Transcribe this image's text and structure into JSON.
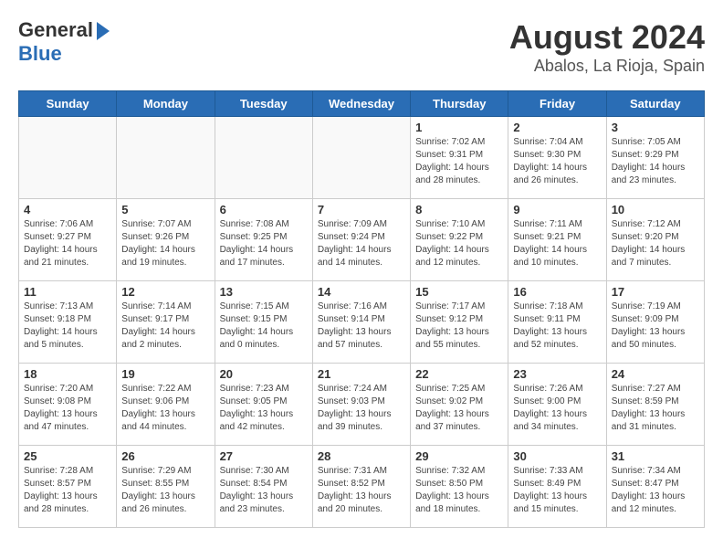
{
  "header": {
    "logo_general": "General",
    "logo_blue": "Blue",
    "month": "August 2024",
    "location": "Abalos, La Rioja, Spain"
  },
  "weekdays": [
    "Sunday",
    "Monday",
    "Tuesday",
    "Wednesday",
    "Thursday",
    "Friday",
    "Saturday"
  ],
  "weeks": [
    [
      {
        "day": "",
        "info": ""
      },
      {
        "day": "",
        "info": ""
      },
      {
        "day": "",
        "info": ""
      },
      {
        "day": "",
        "info": ""
      },
      {
        "day": "1",
        "info": "Sunrise: 7:02 AM\nSunset: 9:31 PM\nDaylight: 14 hours\nand 28 minutes."
      },
      {
        "day": "2",
        "info": "Sunrise: 7:04 AM\nSunset: 9:30 PM\nDaylight: 14 hours\nand 26 minutes."
      },
      {
        "day": "3",
        "info": "Sunrise: 7:05 AM\nSunset: 9:29 PM\nDaylight: 14 hours\nand 23 minutes."
      }
    ],
    [
      {
        "day": "4",
        "info": "Sunrise: 7:06 AM\nSunset: 9:27 PM\nDaylight: 14 hours\nand 21 minutes."
      },
      {
        "day": "5",
        "info": "Sunrise: 7:07 AM\nSunset: 9:26 PM\nDaylight: 14 hours\nand 19 minutes."
      },
      {
        "day": "6",
        "info": "Sunrise: 7:08 AM\nSunset: 9:25 PM\nDaylight: 14 hours\nand 17 minutes."
      },
      {
        "day": "7",
        "info": "Sunrise: 7:09 AM\nSunset: 9:24 PM\nDaylight: 14 hours\nand 14 minutes."
      },
      {
        "day": "8",
        "info": "Sunrise: 7:10 AM\nSunset: 9:22 PM\nDaylight: 14 hours\nand 12 minutes."
      },
      {
        "day": "9",
        "info": "Sunrise: 7:11 AM\nSunset: 9:21 PM\nDaylight: 14 hours\nand 10 minutes."
      },
      {
        "day": "10",
        "info": "Sunrise: 7:12 AM\nSunset: 9:20 PM\nDaylight: 14 hours\nand 7 minutes."
      }
    ],
    [
      {
        "day": "11",
        "info": "Sunrise: 7:13 AM\nSunset: 9:18 PM\nDaylight: 14 hours\nand 5 minutes."
      },
      {
        "day": "12",
        "info": "Sunrise: 7:14 AM\nSunset: 9:17 PM\nDaylight: 14 hours\nand 2 minutes."
      },
      {
        "day": "13",
        "info": "Sunrise: 7:15 AM\nSunset: 9:15 PM\nDaylight: 14 hours\nand 0 minutes."
      },
      {
        "day": "14",
        "info": "Sunrise: 7:16 AM\nSunset: 9:14 PM\nDaylight: 13 hours\nand 57 minutes."
      },
      {
        "day": "15",
        "info": "Sunrise: 7:17 AM\nSunset: 9:12 PM\nDaylight: 13 hours\nand 55 minutes."
      },
      {
        "day": "16",
        "info": "Sunrise: 7:18 AM\nSunset: 9:11 PM\nDaylight: 13 hours\nand 52 minutes."
      },
      {
        "day": "17",
        "info": "Sunrise: 7:19 AM\nSunset: 9:09 PM\nDaylight: 13 hours\nand 50 minutes."
      }
    ],
    [
      {
        "day": "18",
        "info": "Sunrise: 7:20 AM\nSunset: 9:08 PM\nDaylight: 13 hours\nand 47 minutes."
      },
      {
        "day": "19",
        "info": "Sunrise: 7:22 AM\nSunset: 9:06 PM\nDaylight: 13 hours\nand 44 minutes."
      },
      {
        "day": "20",
        "info": "Sunrise: 7:23 AM\nSunset: 9:05 PM\nDaylight: 13 hours\nand 42 minutes."
      },
      {
        "day": "21",
        "info": "Sunrise: 7:24 AM\nSunset: 9:03 PM\nDaylight: 13 hours\nand 39 minutes."
      },
      {
        "day": "22",
        "info": "Sunrise: 7:25 AM\nSunset: 9:02 PM\nDaylight: 13 hours\nand 37 minutes."
      },
      {
        "day": "23",
        "info": "Sunrise: 7:26 AM\nSunset: 9:00 PM\nDaylight: 13 hours\nand 34 minutes."
      },
      {
        "day": "24",
        "info": "Sunrise: 7:27 AM\nSunset: 8:59 PM\nDaylight: 13 hours\nand 31 minutes."
      }
    ],
    [
      {
        "day": "25",
        "info": "Sunrise: 7:28 AM\nSunset: 8:57 PM\nDaylight: 13 hours\nand 28 minutes."
      },
      {
        "day": "26",
        "info": "Sunrise: 7:29 AM\nSunset: 8:55 PM\nDaylight: 13 hours\nand 26 minutes."
      },
      {
        "day": "27",
        "info": "Sunrise: 7:30 AM\nSunset: 8:54 PM\nDaylight: 13 hours\nand 23 minutes."
      },
      {
        "day": "28",
        "info": "Sunrise: 7:31 AM\nSunset: 8:52 PM\nDaylight: 13 hours\nand 20 minutes."
      },
      {
        "day": "29",
        "info": "Sunrise: 7:32 AM\nSunset: 8:50 PM\nDaylight: 13 hours\nand 18 minutes."
      },
      {
        "day": "30",
        "info": "Sunrise: 7:33 AM\nSunset: 8:49 PM\nDaylight: 13 hours\nand 15 minutes."
      },
      {
        "day": "31",
        "info": "Sunrise: 7:34 AM\nSunset: 8:47 PM\nDaylight: 13 hours\nand 12 minutes."
      }
    ]
  ]
}
